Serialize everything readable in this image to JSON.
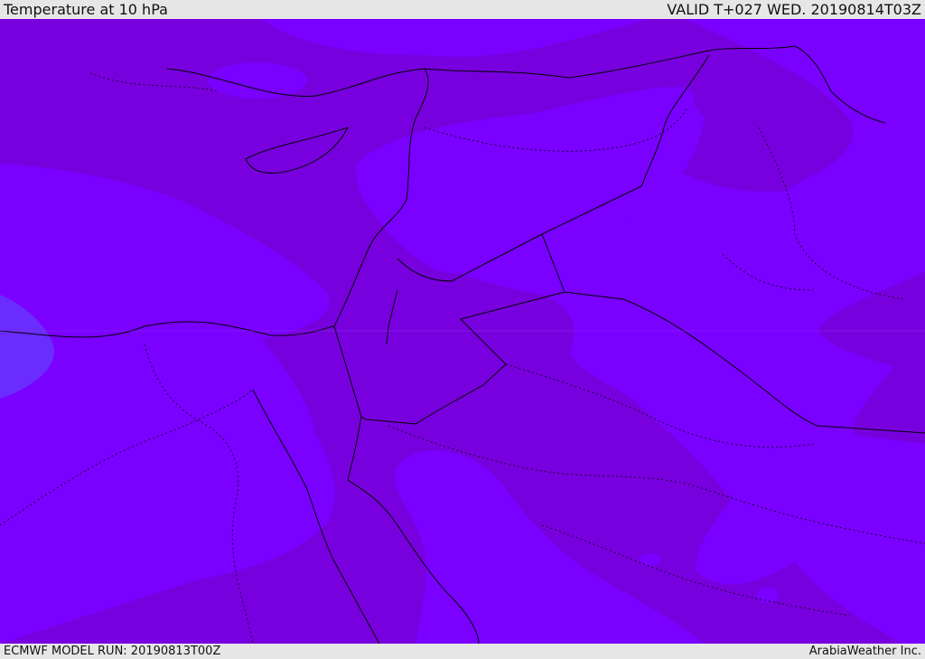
{
  "header": {
    "title": "Temperature at 10 hPa",
    "valid_time": "VALID T+027 WED. 20190814T03Z"
  },
  "footer": {
    "model_run": "ECMWF MODEL RUN: 20190813T00Z",
    "credit": "ArabiaWeather Inc."
  },
  "map": {
    "colors": {
      "light_field": "#7a00ff",
      "dark_field": "#7800de",
      "cold_spot": "#6a2cff",
      "border": "#000000"
    }
  }
}
